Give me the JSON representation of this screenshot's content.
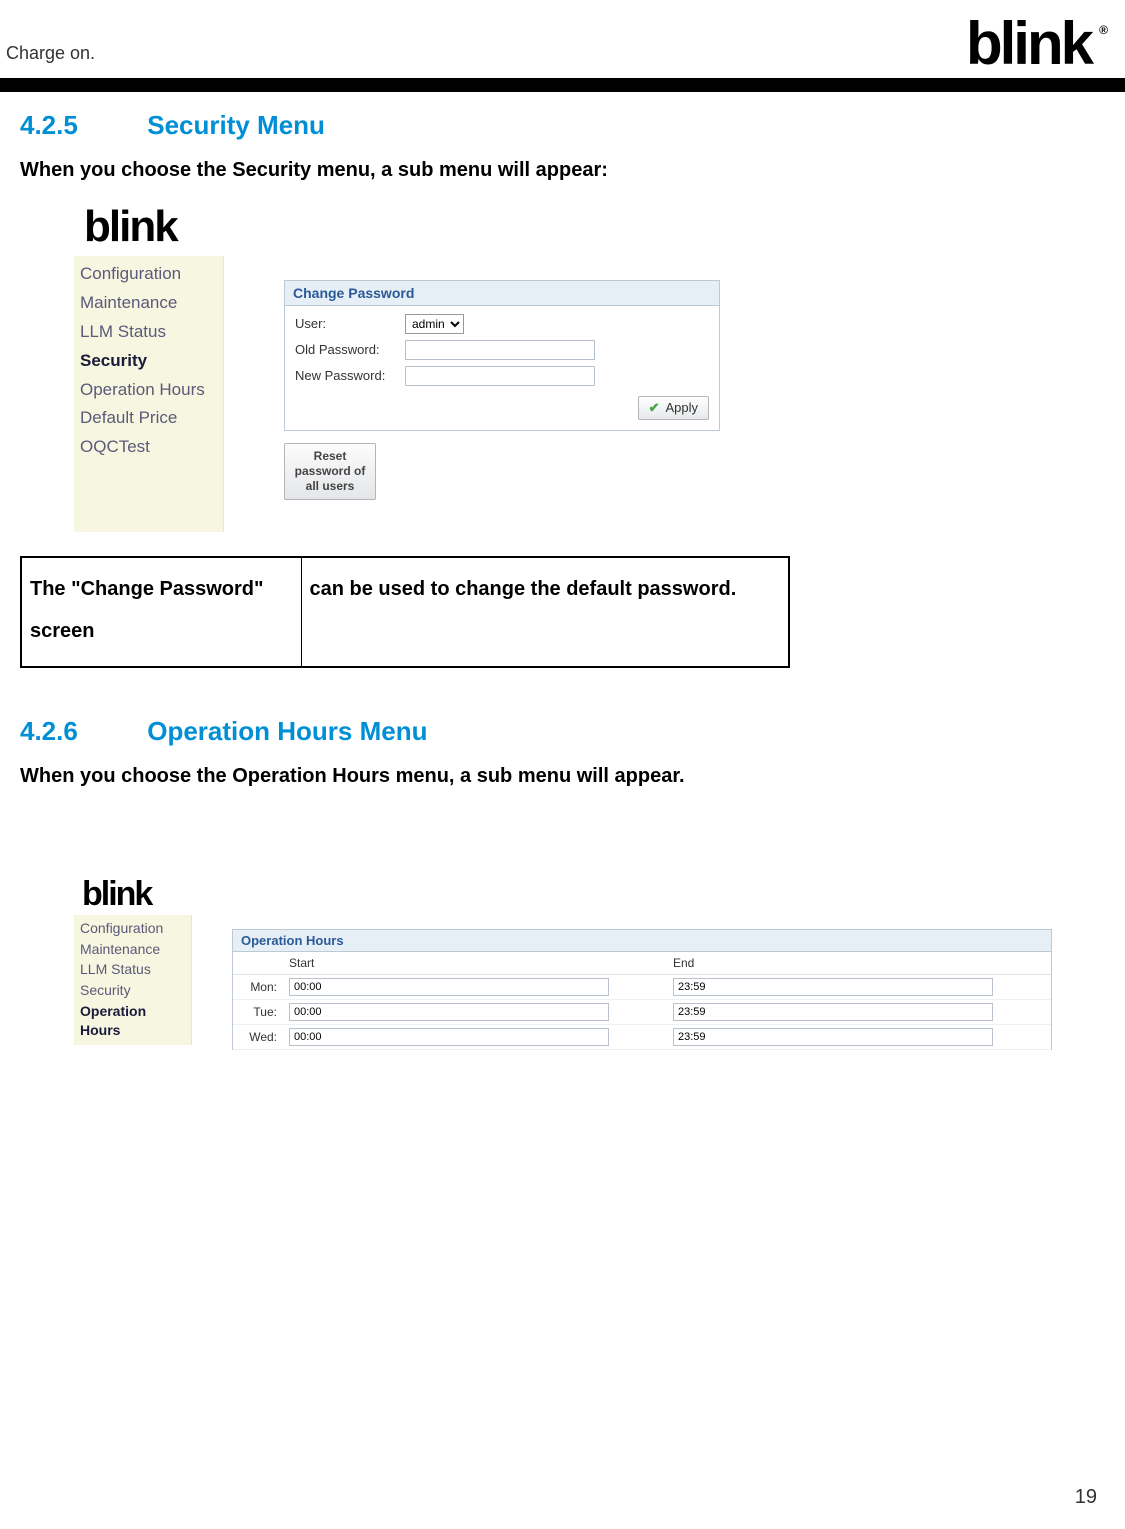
{
  "header": {
    "tagline": "Charge on.",
    "brand": "blink",
    "registered": "®"
  },
  "section1": {
    "num": "4.2.5",
    "title": "Security Menu",
    "intro": "When you choose the Security menu, a sub menu will appear:"
  },
  "app1": {
    "logo": "blink",
    "sidebar": [
      "Configuration",
      "Maintenance",
      "LLM Status",
      "Security",
      "Operation Hours",
      "Default Price",
      "OQCTest"
    ],
    "active_index": 3,
    "panel_title": "Change Password",
    "user_label": "User:",
    "user_value": "admin",
    "old_pw_label": "Old Password:",
    "new_pw_label": "New Password:",
    "apply_label": "Apply",
    "reset_label": "Reset password of all users"
  },
  "desc_table": {
    "col1": "The \"Change Password\" screen",
    "col2": "can be used to change the default password."
  },
  "section2": {
    "num": "4.2.6",
    "title": "Operation Hours Menu",
    "intro": "When you choose the Operation Hours menu, a sub menu will appear."
  },
  "app2": {
    "logo": "blink",
    "sidebar": [
      "Configuration",
      "Maintenance",
      "LLM Status",
      "Security",
      "Operation Hours"
    ],
    "active_index": 4,
    "panel_title": "Operation Hours",
    "start_header": "Start",
    "end_header": "End",
    "rows": [
      {
        "day": "Mon:",
        "start": "00:00",
        "end": "23:59"
      },
      {
        "day": "Tue:",
        "start": "00:00",
        "end": "23:59"
      },
      {
        "day": "Wed:",
        "start": "00:00",
        "end": "23:59"
      }
    ]
  },
  "page_number": "19"
}
